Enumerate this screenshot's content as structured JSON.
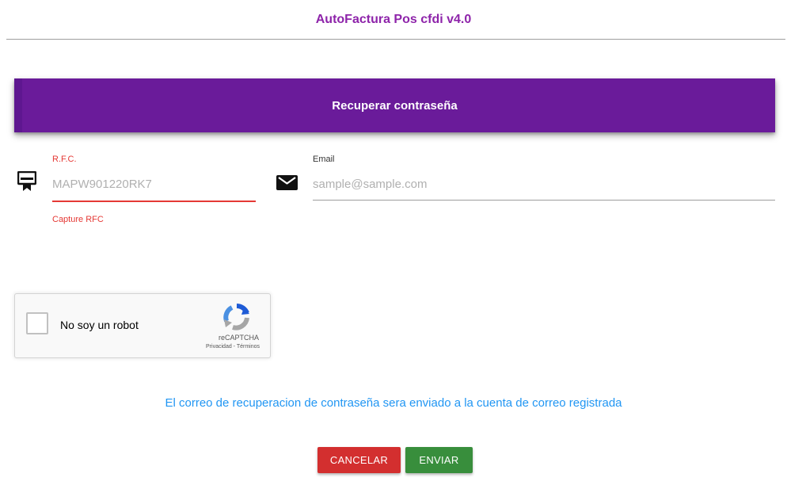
{
  "app": {
    "title": "AutoFactura Pos cfdi v4.0"
  },
  "banner": {
    "title": "Recuperar contraseña"
  },
  "form": {
    "rfc": {
      "label": "R.F.C.",
      "placeholder": "MAPW901220RK7",
      "error": "Capture RFC",
      "icon": "badge-icon"
    },
    "email": {
      "label": "Email",
      "placeholder": "sample@sample.com",
      "icon": "envelope-icon"
    }
  },
  "captcha": {
    "label": "No soy un robot",
    "brand": "reCAPTCHA",
    "links": "Privacidad - Términos",
    "checked": false
  },
  "message": "El correo de recuperacion de contraseña sera enviado a la cuenta de correo registrada",
  "buttons": {
    "cancel": "CANCELAR",
    "send": "ENVIAR"
  },
  "colors": {
    "title": "#8e24aa",
    "banner": "#6a1b9a",
    "error": "#e53935",
    "info": "#2196f3",
    "cancel": "#d32f2f",
    "send": "#388e3c"
  }
}
